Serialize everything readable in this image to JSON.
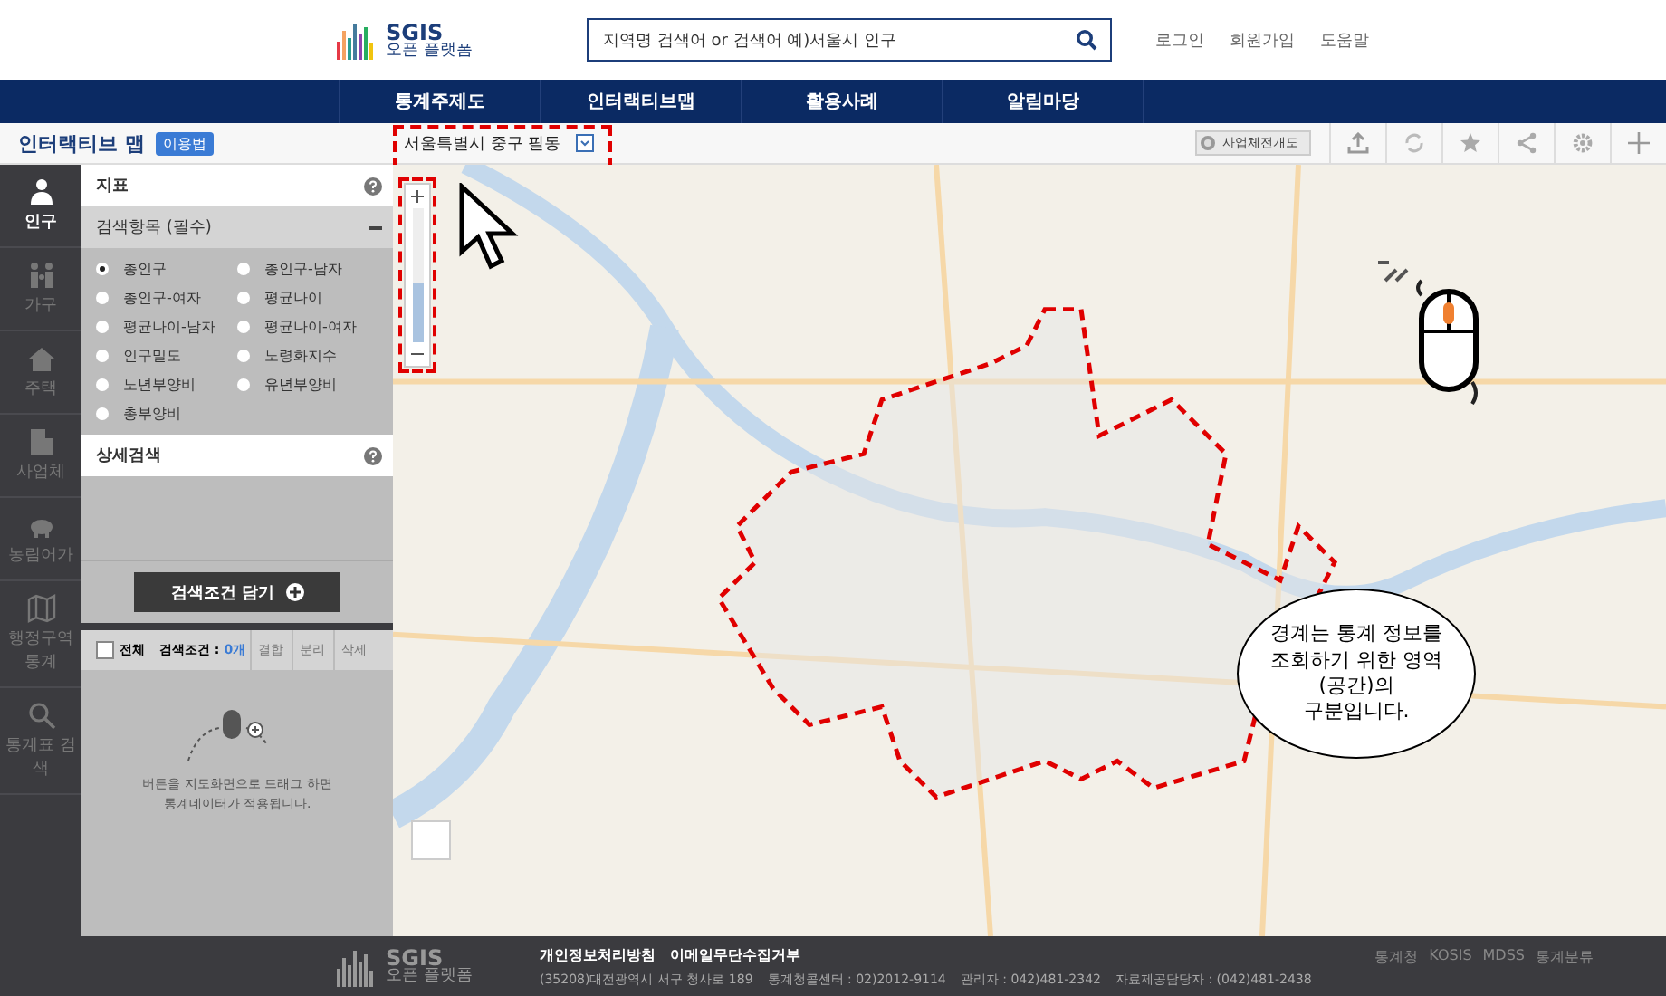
{
  "header": {
    "logo_title": "SGIS",
    "logo_subtitle": "오픈 플랫폼",
    "search": {
      "value": "지역명 검색어 or 검색어 예)서울시 인구"
    },
    "links": [
      "로그인",
      "회원가입",
      "도움말"
    ]
  },
  "nav": [
    "통계주제도",
    "인터랙티브맵",
    "활용사례",
    "알림마당"
  ],
  "toolbar": {
    "title": "인터랙티브 맵",
    "badge": "이용법",
    "location": "서울특별시 중구 필동",
    "toggle": {
      "label": "사업체전개도",
      "on": false
    }
  },
  "sidebar": [
    {
      "label": "인구",
      "kind": "person",
      "selected": true
    },
    {
      "label": "가구",
      "kind": "family",
      "selected": false
    },
    {
      "label": "주택",
      "kind": "house",
      "selected": false
    },
    {
      "label": "사업체",
      "kind": "building",
      "selected": false
    },
    {
      "label": "농림어가",
      "kind": "pig",
      "selected": false
    },
    {
      "label": "행정구역 통계",
      "kind": "map",
      "selected": false
    },
    {
      "label": "통계표 검색",
      "kind": "search",
      "selected": false
    }
  ],
  "panel": {
    "indicator_title": "지표",
    "section_title": "검색항목 (필수)",
    "options": [
      {
        "label": "총인구",
        "selected": true
      },
      {
        "label": "총인구-남자",
        "selected": false
      },
      {
        "label": "총인구-여자",
        "selected": false
      },
      {
        "label": "평균나이",
        "selected": false
      },
      {
        "label": "평균나이-남자",
        "selected": false
      },
      {
        "label": "평균나이-여자",
        "selected": false
      },
      {
        "label": "인구밀도",
        "selected": false
      },
      {
        "label": "노령화지수",
        "selected": false
      },
      {
        "label": "노년부양비",
        "selected": false
      },
      {
        "label": "유년부양비",
        "selected": false
      },
      {
        "label": "총부양비",
        "selected": false
      }
    ],
    "detail_title": "상세검색",
    "add_button": "검색조건 담기",
    "select_all": {
      "label": "전체",
      "checked": false
    },
    "condition_label": "검색조건 : ",
    "condition_count": "0개",
    "actions": [
      "결합",
      "분리",
      "삭제"
    ],
    "hint": "버튼을 지도화면으로 드래그 하면 통계데이터가 적용됩니다."
  },
  "map": {
    "zoom": {
      "level": 0.45
    },
    "callout": "경계는 통계 정보를 조회하기 위한 영역(공간)의 구분입니다."
  },
  "footer": {
    "logo_title": "SGIS",
    "logo_subtitle": "오픈 플랫폼",
    "links": [
      "개인정보처리방침",
      "이메일무단수집거부"
    ],
    "address": "(35208)대전광역시 서구 청사로 189",
    "contacts": [
      "통계청콜센터 : 02)2012-9114",
      "관리자 : 042)481-2342",
      "자료제공담당자 : (042)481-2438"
    ],
    "sites": [
      "통계청",
      "KOSIS",
      "MDSS",
      "통계분류"
    ]
  }
}
